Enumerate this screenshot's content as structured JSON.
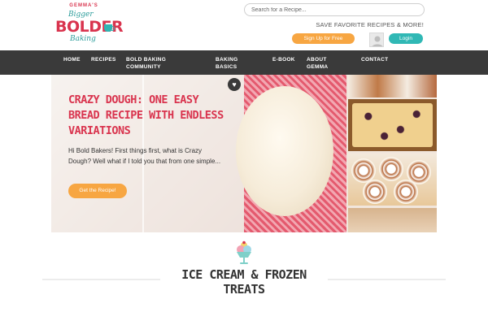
{
  "brand": {
    "arc_text": "GEMMA'S",
    "line1": "Bigger",
    "line2": "BOLDER",
    "line3": "Baking"
  },
  "header": {
    "search_placeholder": "Search for a Recipe...",
    "save_text": "SAVE FAVORITE RECIPES & MORE!",
    "signup_label": "Sign Up for Free",
    "login_label": "Login"
  },
  "nav": {
    "items": [
      {
        "label": "HOME"
      },
      {
        "label": "RECIPES"
      },
      {
        "label": "BOLD BAKING COMMUNITY"
      },
      {
        "label": "BAKING BASICS"
      },
      {
        "label": "E-BOOK"
      },
      {
        "label": "ABOUT GEMMA"
      },
      {
        "label": "CONTACT"
      }
    ]
  },
  "hero": {
    "title": "Crazy Dough: One Easy Bread Recipe with Endless Variations",
    "excerpt": "Hi Bold Bakers! First things first, what is Crazy Dough? Well what if I told you that from one simple...",
    "button_label": "Get the Recipe!",
    "favorite_icon": "heart-icon"
  },
  "section": {
    "title": "ICE CREAM & FROZEN TREATS",
    "icon": "ice-cream-sundae-icon"
  },
  "colors": {
    "brand_red": "#d9344e",
    "brand_teal": "#30b8b5",
    "accent_orange": "#f7a642",
    "nav_bg": "#3a3a3a"
  }
}
